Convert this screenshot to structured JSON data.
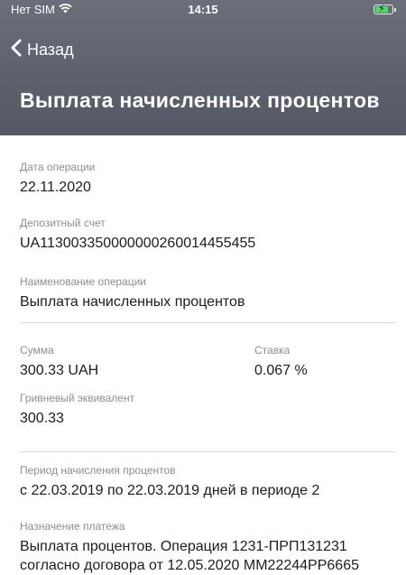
{
  "status_bar": {
    "carrier": "Нет SIM",
    "time": "14:15"
  },
  "nav": {
    "back_label": "Назад",
    "title": "Выплата начисленных процентов"
  },
  "details": {
    "operation_date": {
      "label": "Дата операции",
      "value": "22.11.2020"
    },
    "deposit_account": {
      "label": "Депозитный счет",
      "value": "UA113003350000000260014455455"
    },
    "operation_name": {
      "label": "Наименование операции",
      "value": "Выплата начисленных процентов"
    },
    "amount": {
      "label": "Сумма",
      "value": "300.33 UAH"
    },
    "rate": {
      "label": "Ставка",
      "value": "0.067 %"
    },
    "uah_equivalent": {
      "label": "Гривневый эквивалент",
      "value": "300.33"
    },
    "accrual_period": {
      "label": "Период начисления процентов",
      "value": "с 22.03.2019 по 22.03.2019 дней в периоде 2"
    },
    "payment_purpose": {
      "label": "Назначение платежа",
      "value": "Выплата процентов. Операция 1231-ПРП131231 согласно договора от 12.05.2020 ММ22244РР6665"
    }
  },
  "colors": {
    "header_background": "#5d616c",
    "label_text": "#8e8e93",
    "value_text": "#1c1c1e",
    "divider": "#d8d8dc",
    "battery_charging": "#4cd964"
  },
  "icons": {
    "wifi": "wifi-icon",
    "battery": "battery-charging-icon",
    "back": "chevron-left-icon"
  }
}
